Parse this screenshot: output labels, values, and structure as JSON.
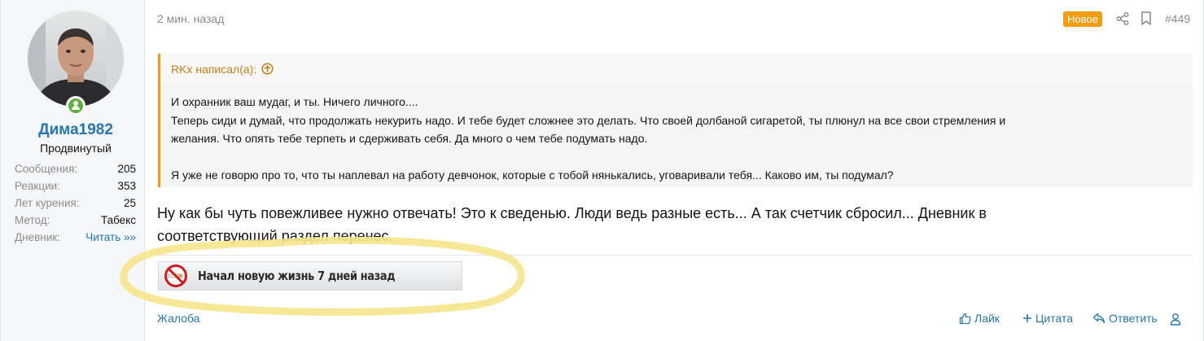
{
  "user": {
    "name": "Дима1982",
    "title": "Продвинутый",
    "online": true,
    "stats": [
      {
        "label": "Сообщения:",
        "value": "205"
      },
      {
        "label": "Реакции:",
        "value": "353"
      },
      {
        "label": "Лет курения:",
        "value": "25"
      },
      {
        "label": "Метод:",
        "value": "Табекс"
      },
      {
        "label": "Дневник:",
        "value": "Читать »»"
      }
    ]
  },
  "post": {
    "time": "2 мин. назад",
    "badge": "Новое",
    "number": "#449"
  },
  "quote": {
    "author": "RKx написал(а):",
    "lines": [
      "И охранник ваш мудаг, и ты. Ничего личного....",
      "Теперь сиди и думай, что продолжать некурить надо. И тебе будет сложнее это делать. Что своей долбаной сигаретой, ты плюнул на все свои стремления и",
      "желания. Что опять тебе терпеть и сдерживать себя. Да много о чем тебе подумать надо."
    ],
    "last_line": "Я уже не говорю про то, что ты наплевал на работу девчонок, которые с тобой нянькались, уговаривали тебя... Каково им, ты подумал?"
  },
  "message": {
    "line1": "Ну как бы чуть повежливее нужно отвечать! Это к сведенью. Люди ведь разные есть... А так счетчик сбросил... Дневник в",
    "line2": "соответствующий раздел перенес."
  },
  "signature": {
    "text": "Начал новую жизнь 7 дней назад",
    "icon": "no-smoking-icon"
  },
  "actions": {
    "report": "Жалоба",
    "like": "Лайк",
    "quote": "Цитата",
    "reply": "Ответить"
  },
  "colors": {
    "accent": "#f39c12",
    "link": "#2577b1",
    "online": "#5fae3e",
    "highlight": "#f5e68c"
  }
}
